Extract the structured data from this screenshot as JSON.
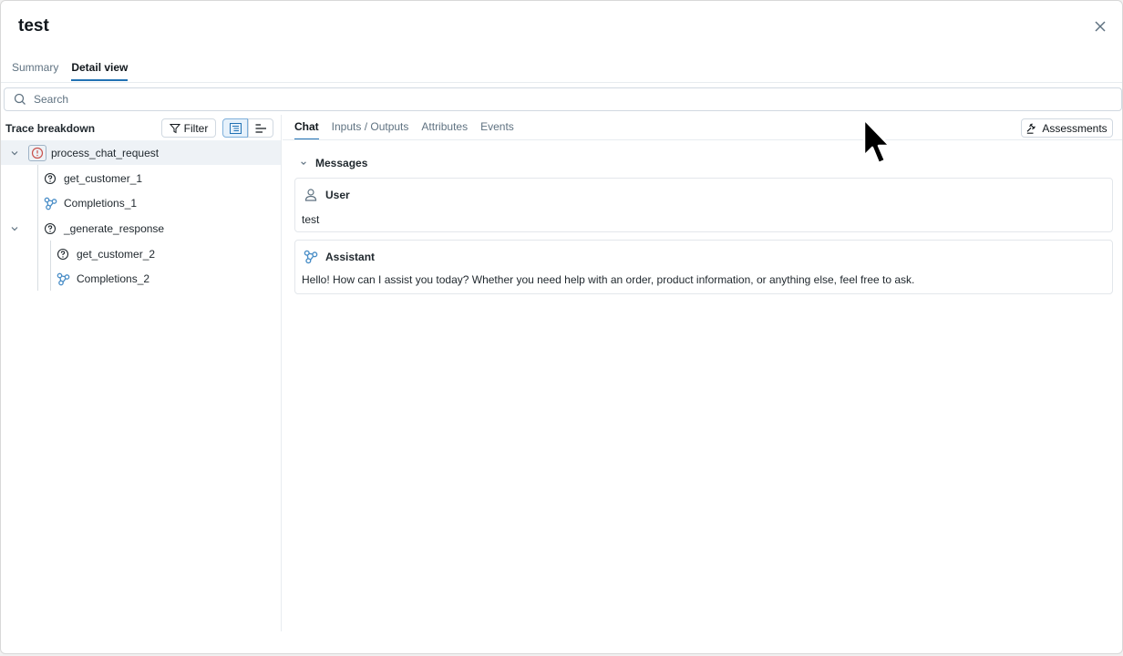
{
  "modal": {
    "title": "test"
  },
  "tabs": [
    {
      "label": "Summary"
    },
    {
      "label": "Detail view"
    }
  ],
  "search": {
    "placeholder": "Search",
    "value": ""
  },
  "trace": {
    "title": "Trace breakdown",
    "filter_label": "Filter",
    "items": [
      {
        "label": "process_chat_request",
        "icon": "warning-circle-icon"
      },
      {
        "label": "get_customer_1",
        "icon": "question-circle-icon"
      },
      {
        "label": "Completions_1",
        "icon": "llm-model-icon"
      },
      {
        "label": "_generate_response",
        "icon": "question-circle-icon"
      },
      {
        "label": "get_customer_2",
        "icon": "question-circle-icon"
      },
      {
        "label": "Completions_2",
        "icon": "llm-model-icon"
      }
    ]
  },
  "detail": {
    "tabs": [
      {
        "label": "Chat"
      },
      {
        "label": "Inputs / Outputs"
      },
      {
        "label": "Attributes"
      },
      {
        "label": "Events"
      }
    ],
    "assessments_label": "Assessments",
    "messages_header": "Messages",
    "messages": [
      {
        "role": "User",
        "icon": "user-icon",
        "content": "test"
      },
      {
        "role": "Assistant",
        "icon": "llm-model-icon",
        "content": "Hello! How can I assist you today? Whether you need help with an order, product information, or anything else, feel free to ask."
      }
    ]
  },
  "colors": {
    "accent": "#2272b4",
    "llm_icon": "#4a8ec7",
    "error_icon": "#c8504b"
  }
}
